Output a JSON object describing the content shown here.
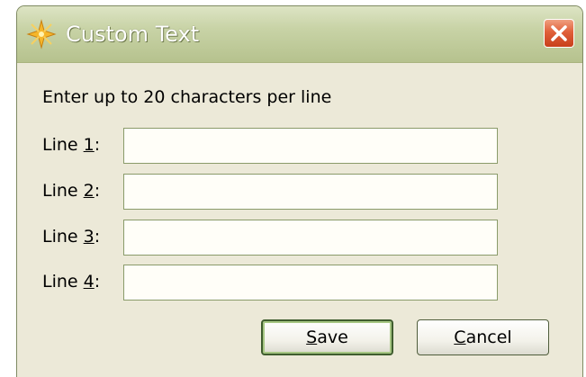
{
  "window": {
    "title": "Custom Text",
    "icon": "sparkle-star-icon",
    "close_icon": "close-x-icon"
  },
  "prompt": "Enter up to 20 characters per line",
  "lines": [
    {
      "prefix": "Line ",
      "key": "1",
      "suffix": ":",
      "value": ""
    },
    {
      "prefix": "Line ",
      "key": "2",
      "suffix": ":",
      "value": ""
    },
    {
      "prefix": "Line ",
      "key": "3",
      "suffix": ":",
      "value": ""
    },
    {
      "prefix": "Line ",
      "key": "4",
      "suffix": ":",
      "value": ""
    }
  ],
  "buttons": {
    "save": {
      "key": "S",
      "rest": "ave"
    },
    "cancel": {
      "key": "C",
      "rest": "ancel"
    }
  },
  "colors": {
    "title_bar": "#c8d3a6",
    "close_button": "#e0603a",
    "dialog_bg": "#ece9d8",
    "input_border": "#8a9b6a"
  }
}
